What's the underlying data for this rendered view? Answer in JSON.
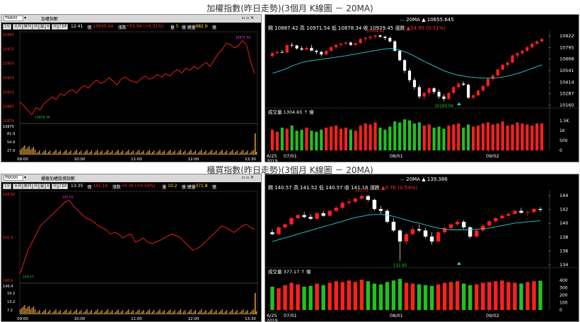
{
  "top": {
    "title": "加權指數(昨日走勢)(3個月 K線圖 － 20MA)",
    "intraday": {
      "symbol": "TWA00",
      "name": "加權指數",
      "buttons": [
        "1分",
        "大列",
        "數列",
        "列",
        "圖",
        "9",
        "列",
        "CDP"
      ],
      "time": "12:41",
      "price_label": "價",
      "price": "10930.44",
      "change_label": "漲跌",
      "change": "+55.94 (+0.51%)",
      "vol_label": "量",
      "vol": "5",
      "total_label": "總量",
      "total": "982.9",
      "total_unit": "億",
      "vol_unit": "億",
      "y_labels": [
        "10993",
        "10975",
        "10950",
        "10925",
        "10915",
        "10895",
        "10875"
      ],
      "ref_price": "10875",
      "high_label": "10971.54",
      "low_label": "10878.34",
      "vol_y_labels": [
        "81.9",
        "54.9",
        "27.9"
      ],
      "x_labels": [
        "09:00",
        "10:00",
        "11:00",
        "12:00",
        "13:30"
      ],
      "price_path": [
        10895,
        10890,
        10884,
        10879,
        10888,
        10885,
        10893,
        10897,
        10901,
        10898,
        10905,
        10903,
        10908,
        10910,
        10906,
        10912,
        10915,
        10912,
        10918,
        10922,
        10918,
        10920,
        10925,
        10921,
        10916,
        10923,
        10926,
        10922,
        10920,
        10919,
        10924,
        10927,
        10923,
        10925,
        10929,
        10926,
        10930,
        10927,
        10932,
        10935,
        10931,
        10937,
        10934,
        10939,
        10936,
        10940,
        10944,
        10939,
        10947,
        10955,
        10960,
        10968,
        10966,
        10962,
        10965,
        10971,
        10966,
        10945,
        10930
      ]
    },
    "kline": {
      "ohlc_text": "開 10887.42  高 10971.54  低 10878.34  收 10929.45  漲跌",
      "change": "▲54.95 (0.51%)",
      "ma_label": "20MA",
      "ma_value": "▲ 10655.645",
      "high_mark": "10994.48",
      "low_mark": "10160.04",
      "y_labels": [
        "10922",
        "10795",
        "10668",
        "10541",
        "10414",
        "10287",
        "10160"
      ],
      "vol_text": "成交量  1304.65  ↑  億",
      "vol_y_labels": [
        "1.5K",
        "1K",
        "500",
        "0"
      ],
      "x_labels": [
        "6/25",
        "07/01",
        "08/01",
        "09/02"
      ],
      "year": "2019",
      "candles": [
        [
          10745,
          10790,
          10730,
          10770
        ],
        [
          10770,
          10800,
          10760,
          10780
        ],
        [
          10780,
          10800,
          10770,
          10775
        ],
        [
          10775,
          10830,
          10770,
          10840
        ],
        [
          10840,
          10860,
          10820,
          10835
        ],
        [
          10835,
          10840,
          10800,
          10810
        ],
        [
          10810,
          10830,
          10790,
          10800
        ],
        [
          10800,
          10830,
          10790,
          10815
        ],
        [
          10815,
          10840,
          10800,
          10790
        ],
        [
          10790,
          10800,
          10760,
          10780
        ],
        [
          10780,
          10790,
          10740,
          10760
        ],
        [
          10760,
          10800,
          10750,
          10790
        ],
        [
          10790,
          10830,
          10780,
          10820
        ],
        [
          10820,
          10850,
          10800,
          10840
        ],
        [
          10840,
          10860,
          10820,
          10850
        ],
        [
          10850,
          10870,
          10830,
          10860
        ],
        [
          10860,
          10870,
          10830,
          10840
        ],
        [
          10840,
          10860,
          10820,
          10855
        ],
        [
          10855,
          10900,
          10850,
          10890
        ],
        [
          10890,
          10910,
          10870,
          10900
        ],
        [
          10900,
          10920,
          10880,
          10910
        ],
        [
          10910,
          10930,
          10890,
          10920
        ],
        [
          10920,
          10930,
          10900,
          10910
        ],
        [
          10910,
          10920,
          10880,
          10900
        ],
        [
          10900,
          10910,
          10860,
          10870
        ],
        [
          10870,
          10880,
          10780,
          10790
        ],
        [
          10790,
          10800,
          10700,
          10710
        ],
        [
          10710,
          10720,
          10600,
          10620
        ],
        [
          10620,
          10640,
          10520,
          10540
        ],
        [
          10540,
          10560,
          10460,
          10480
        ],
        [
          10480,
          10500,
          10380,
          10400
        ],
        [
          10400,
          10440,
          10370,
          10430
        ],
        [
          10430,
          10480,
          10400,
          10470
        ],
        [
          10470,
          10480,
          10420,
          10440
        ],
        [
          10440,
          10460,
          10380,
          10400
        ],
        [
          10400,
          10420,
          10360,
          10380
        ],
        [
          10380,
          10440,
          10370,
          10430
        ],
        [
          10430,
          10490,
          10420,
          10480
        ],
        [
          10480,
          10520,
          10460,
          10510
        ],
        [
          10510,
          10530,
          10490,
          10500
        ],
        [
          10500,
          10510,
          10380,
          10390
        ],
        [
          10390,
          10420,
          10370,
          10410
        ],
        [
          10410,
          10460,
          10400,
          10450
        ],
        [
          10450,
          10500,
          10440,
          10490
        ],
        [
          10490,
          10560,
          10480,
          10550
        ],
        [
          10550,
          10590,
          10530,
          10580
        ],
        [
          10580,
          10640,
          10570,
          10630
        ],
        [
          10630,
          10680,
          10620,
          10670
        ],
        [
          10670,
          10700,
          10650,
          10690
        ],
        [
          10690,
          10760,
          10680,
          10750
        ],
        [
          10750,
          10780,
          10730,
          10770
        ],
        [
          10770,
          10800,
          10750,
          10790
        ],
        [
          10790,
          10830,
          10780,
          10820
        ],
        [
          10820,
          10860,
          10810,
          10850
        ],
        [
          10850,
          10880,
          10840,
          10870
        ],
        [
          10870,
          10900,
          10860,
          10890
        ]
      ],
      "ma": [
        10600,
        10610,
        10625,
        10640,
        10660,
        10675,
        10690,
        10700,
        10705,
        10712,
        10718,
        10724,
        10730,
        10736,
        10742,
        10748,
        10755,
        10762,
        10770,
        10778,
        10785,
        10792,
        10800,
        10806,
        10810,
        10806,
        10796,
        10782,
        10765,
        10745,
        10722,
        10700,
        10680,
        10660,
        10640,
        10620,
        10605,
        10592,
        10582,
        10575,
        10568,
        10563,
        10560,
        10558,
        10557,
        10558,
        10561,
        10566,
        10574,
        10584,
        10596,
        10610,
        10625,
        10640,
        10655,
        10670
      ],
      "volumes": [
        1000,
        900,
        1100,
        1050,
        1200,
        950,
        1000,
        1100,
        950,
        900,
        1000,
        1100,
        1150,
        1200,
        1050,
        1100,
        1000,
        950,
        1200,
        1300,
        1250,
        1350,
        1100,
        1000,
        1150,
        1400,
        1350,
        1500,
        1450,
        1300,
        1350,
        1200,
        1250,
        1100,
        1150,
        1050,
        1200,
        1250,
        1300,
        1100,
        1250,
        1150,
        1200,
        1300,
        1350,
        1250,
        1300,
        1400,
        1200,
        1250,
        1350,
        1300,
        1250,
        1200,
        1300,
        1304
      ]
    }
  },
  "bottom": {
    "title": "櫃買指數(昨日走勢)(3個月 K線圖 － 20MA)",
    "intraday": {
      "symbol": "TWO00",
      "name": "櫃檯加權股價指數",
      "buttons": [
        "1分",
        "大列",
        "數列",
        "列",
        "圖",
        "9",
        "列",
        "CDP"
      ],
      "time": "13:35",
      "price_label": "價",
      "price": "141.16",
      "change_label": "漲跌",
      "change": "+0.76 (+0.54%)",
      "vol_label": "量",
      "vol": "10.2",
      "total_label": "總量",
      "total": "371.8",
      "total_unit": "億",
      "vol_unit": "億",
      "y_labels": [
        "143.82",
        "141.9",
        "140.9"
      ],
      "ref_price": "140.4",
      "high_label": "141.52",
      "low_label": "140.57",
      "vol_y_labels": [
        "19.2",
        "13.2",
        "7.2"
      ],
      "x_labels": [
        "09:00",
        "10:00",
        "11:00",
        "12:00",
        "13:30"
      ],
      "price_path": [
        140.6,
        140.75,
        140.9,
        141.0,
        141.1,
        141.2,
        141.25,
        141.3,
        141.35,
        141.4,
        141.45,
        141.5,
        141.52,
        141.45,
        141.4,
        141.35,
        141.3,
        141.28,
        141.25,
        141.2,
        141.18,
        141.15,
        141.1,
        141.12,
        141.1,
        141.05,
        141.08,
        141.1,
        141.0,
        141.02,
        141.05,
        141.0,
        140.98,
        141.0,
        141.02,
        141.05,
        141.08,
        141.1,
        141.08,
        141.05,
        141.0,
        140.95,
        140.9,
        140.92,
        140.95,
        141.0,
        141.05,
        141.1,
        141.15,
        141.2,
        141.18,
        141.15,
        141.12,
        141.16,
        141.2,
        141.22,
        141.18,
        141.16
      ]
    },
    "kline": {
      "ohlc_text": "開 140.57  高 141.52  低 140.57  收 141.16  漲跌",
      "change": "▲0.76 (0.54%)",
      "ma_label": "20MA",
      "ma_value": "▲ 139.386",
      "high_mark": "143.75",
      "low_mark": "132.85",
      "y_labels": [
        "144",
        "142",
        "140",
        "138",
        "136",
        "134"
      ],
      "vol_text": "成交量  377.17  ↑  億",
      "vol_y_labels": [
        "400",
        "300",
        "200",
        "100",
        "0"
      ],
      "x_labels": [
        "6/25",
        "07/01",
        "08/01",
        "09/02"
      ],
      "year": "2019",
      "candles": [
        [
          137.5,
          138.0,
          137.0,
          137.2
        ],
        [
          137.2,
          138.5,
          137.0,
          138.3
        ],
        [
          138.3,
          139.0,
          138.0,
          138.8
        ],
        [
          138.8,
          140.0,
          138.5,
          139.8
        ],
        [
          139.8,
          140.5,
          139.5,
          140.3
        ],
        [
          140.3,
          140.8,
          139.8,
          140.0
        ],
        [
          140.0,
          140.5,
          139.5,
          139.7
        ],
        [
          139.7,
          140.8,
          139.5,
          140.6
        ],
        [
          140.6,
          141.0,
          140.0,
          140.2
        ],
        [
          140.2,
          141.2,
          140.0,
          141.0
        ],
        [
          141.0,
          141.8,
          140.8,
          141.5
        ],
        [
          141.5,
          142.5,
          141.2,
          142.3
        ],
        [
          142.3,
          143.0,
          142.0,
          142.5
        ],
        [
          142.5,
          143.2,
          142.2,
          143.0
        ],
        [
          143.0,
          143.75,
          142.8,
          143.4
        ],
        [
          143.4,
          143.6,
          142.5,
          142.8
        ],
        [
          142.8,
          143.0,
          141.0,
          141.3
        ],
        [
          141.3,
          141.8,
          140.5,
          141.0
        ],
        [
          141.0,
          141.3,
          139.0,
          139.2
        ],
        [
          139.2,
          139.8,
          137.5,
          137.8
        ],
        [
          137.8,
          138.0,
          132.85,
          136.0
        ],
        [
          136.0,
          137.5,
          135.5,
          137.2
        ],
        [
          137.2,
          138.5,
          137.0,
          138.0
        ],
        [
          138.0,
          138.8,
          137.5,
          137.8
        ],
        [
          137.8,
          138.2,
          136.5,
          136.8
        ],
        [
          136.8,
          137.5,
          135.5,
          136.0
        ],
        [
          136.0,
          137.8,
          135.8,
          137.5
        ],
        [
          137.5,
          138.5,
          137.2,
          138.2
        ],
        [
          138.2,
          139.0,
          138.0,
          138.8
        ],
        [
          138.8,
          139.5,
          138.5,
          139.2
        ],
        [
          139.2,
          139.5,
          138.0,
          138.3
        ],
        [
          138.3,
          138.5,
          136.5,
          136.8
        ],
        [
          136.8,
          138.0,
          136.5,
          137.8
        ],
        [
          137.8,
          138.8,
          137.5,
          138.6
        ],
        [
          138.6,
          139.5,
          138.5,
          139.3
        ],
        [
          139.3,
          140.0,
          139.0,
          139.8
        ],
        [
          139.8,
          140.5,
          139.5,
          140.2
        ],
        [
          140.2,
          140.8,
          140.0,
          140.5
        ],
        [
          140.5,
          141.2,
          140.3,
          141.0
        ],
        [
          141.0,
          141.5,
          140.5,
          140.7
        ],
        [
          140.7,
          141.0,
          140.2,
          140.8
        ],
        [
          140.8,
          141.5,
          140.5,
          141.3
        ],
        [
          141.3,
          141.6,
          140.8,
          141.16
        ]
      ],
      "ma": [
        136.0,
        136.3,
        136.6,
        136.9,
        137.2,
        137.5,
        137.8,
        138.1,
        138.4,
        138.7,
        139.0,
        139.3,
        139.6,
        139.9,
        140.1,
        140.3,
        140.4,
        140.4,
        140.3,
        140.1,
        139.8,
        139.5,
        139.2,
        139.0,
        138.7,
        138.4,
        138.2,
        138.0,
        137.9,
        137.9,
        137.9,
        137.9,
        138.0,
        138.1,
        138.2,
        138.4,
        138.6,
        138.8,
        139.0,
        139.1,
        139.2,
        139.3,
        139.386
      ],
      "volumes": [
        300,
        280,
        320,
        350,
        330,
        300,
        310,
        340,
        320,
        350,
        370,
        360,
        380,
        360,
        390,
        370,
        340,
        330,
        360,
        380,
        400,
        350,
        340,
        330,
        320,
        310,
        330,
        350,
        360,
        370,
        340,
        320,
        330,
        350,
        360,
        370,
        380,
        360,
        350,
        340,
        360,
        370,
        377
      ]
    }
  }
}
